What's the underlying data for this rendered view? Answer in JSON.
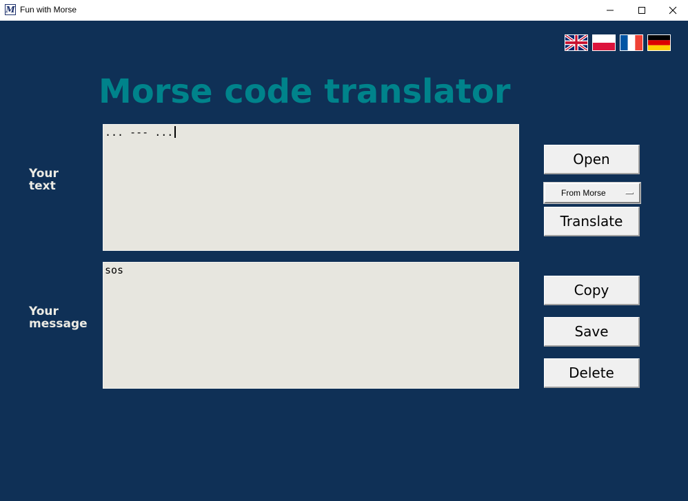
{
  "window": {
    "title": "Fun with Morse",
    "icon": "morse-m-icon",
    "controls": [
      "minimize-icon",
      "maximize-icon",
      "close-icon"
    ]
  },
  "languages": [
    {
      "name": "flag-uk-icon"
    },
    {
      "name": "flag-poland-icon"
    },
    {
      "name": "flag-france-icon"
    },
    {
      "name": "flag-germany-icon"
    }
  ],
  "page_title": "Morse code translator",
  "input": {
    "label_line1": "Your",
    "label_line2": "text",
    "value": "... --- ..."
  },
  "output": {
    "label_line1": "Your",
    "label_line2": "message",
    "value": "sos"
  },
  "buttons": {
    "open": "Open",
    "translate": "Translate",
    "copy": "Copy",
    "save": "Save",
    "delete": "Delete"
  },
  "direction_select": {
    "selected": "From Morse"
  },
  "colors": {
    "background": "#0f3056",
    "title": "#00838b",
    "textbox": "#e7e6df",
    "label": "#ecebe4"
  }
}
